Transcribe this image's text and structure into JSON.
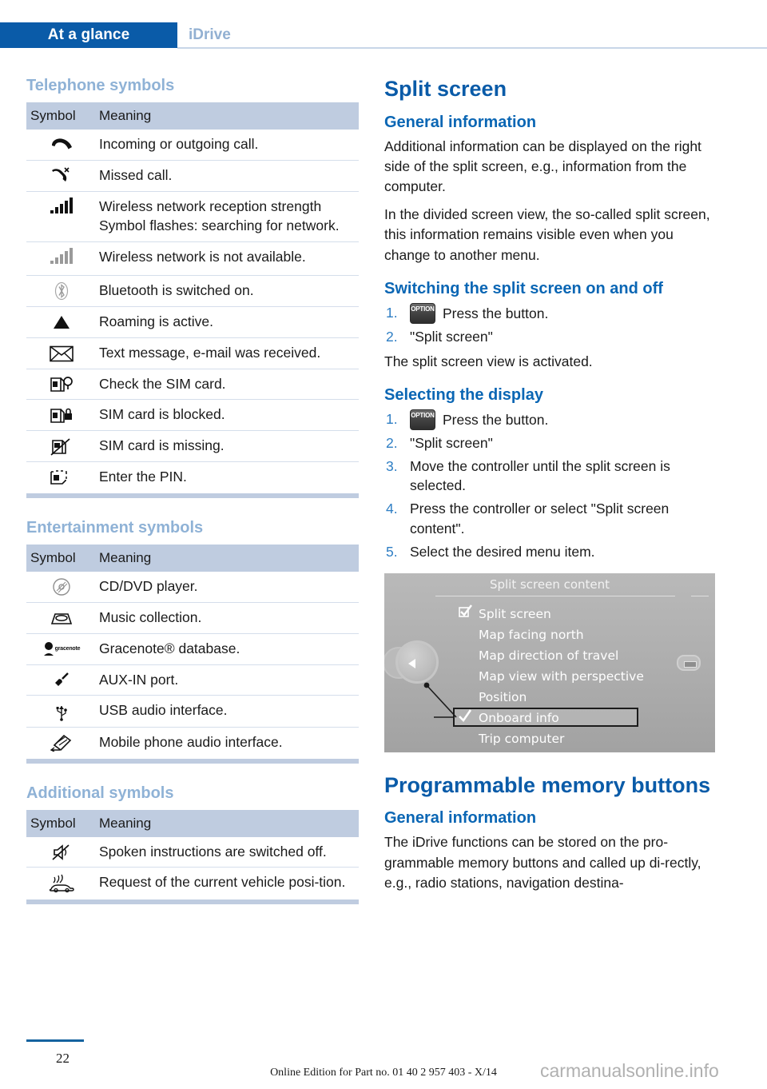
{
  "header": {
    "active_tab": "At a glance",
    "inactive_tab": "iDrive"
  },
  "left_column": {
    "telephone": {
      "heading": "Telephone symbols",
      "columns": {
        "symbol": "Symbol",
        "meaning": "Meaning"
      },
      "rows": [
        {
          "icon": "phone-handset-icon",
          "meaning": "Incoming or outgoing call."
        },
        {
          "icon": "missed-call-icon",
          "meaning": "Missed call."
        },
        {
          "icon": "signal-bars-icon",
          "meaning": "Wireless network reception strength Symbol flashes: searching for network."
        },
        {
          "icon": "signal-bars-grey-icon",
          "meaning": "Wireless network is not available."
        },
        {
          "icon": "bluetooth-icon",
          "meaning": "Bluetooth is switched on."
        },
        {
          "icon": "roaming-triangle-icon",
          "meaning": "Roaming is active."
        },
        {
          "icon": "envelope-icon",
          "meaning": "Text message, e-mail was received."
        },
        {
          "icon": "sim-check-icon",
          "meaning": "Check the SIM card."
        },
        {
          "icon": "sim-locked-icon",
          "meaning": "SIM card is blocked."
        },
        {
          "icon": "sim-missing-icon",
          "meaning": "SIM card is missing."
        },
        {
          "icon": "sim-pin-icon",
          "meaning": "Enter the PIN."
        }
      ]
    },
    "entertainment": {
      "heading": "Entertainment symbols",
      "columns": {
        "symbol": "Symbol",
        "meaning": "Meaning"
      },
      "rows": [
        {
          "icon": "cd-dvd-icon",
          "meaning": "CD/DVD player."
        },
        {
          "icon": "music-collection-icon",
          "meaning": "Music collection."
        },
        {
          "icon": "gracenote-icon",
          "icon_label": "gracenote",
          "meaning": "Gracenote® database."
        },
        {
          "icon": "aux-in-plug-icon",
          "meaning": "AUX-IN port."
        },
        {
          "icon": "usb-icon",
          "meaning": "USB audio interface."
        },
        {
          "icon": "mobile-audio-icon",
          "meaning": "Mobile phone audio interface."
        }
      ]
    },
    "additional": {
      "heading": "Additional symbols",
      "columns": {
        "symbol": "Symbol",
        "meaning": "Meaning"
      },
      "rows": [
        {
          "icon": "speaker-muted-icon",
          "meaning": "Spoken instructions are switched off."
        },
        {
          "icon": "vehicle-position-icon",
          "meaning": "Request of the current vehicle posi-tion."
        }
      ]
    }
  },
  "right_column": {
    "split_screen": {
      "title": "Split screen",
      "general_heading": "General information",
      "general_p1": "Additional information can be displayed on the right side of the split screen, e.g., information from the computer.",
      "general_p2": "In the divided screen view, the so-called split screen, this information remains visible even when you change to another menu.",
      "switching_heading": "Switching the split screen on and off",
      "switching_steps": [
        {
          "num": "1.",
          "icon": "option-button-icon",
          "icon_label": "OPTION",
          "text": "Press the button."
        },
        {
          "num": "2.",
          "text": "\"Split screen\""
        }
      ],
      "switching_result": "The split screen view is activated.",
      "selecting_heading": "Selecting the display",
      "selecting_steps": [
        {
          "num": "1.",
          "icon": "option-button-icon",
          "icon_label": "OPTION",
          "text": "Press the button."
        },
        {
          "num": "2.",
          "text": "\"Split screen\""
        },
        {
          "num": "3.",
          "text": "Move the controller until the split screen is selected."
        },
        {
          "num": "4.",
          "text": "Press the controller or select \"Split screen content\"."
        },
        {
          "num": "5.",
          "text": "Select the desired menu item."
        }
      ],
      "idrive_image": {
        "title": "Split screen content",
        "items": [
          {
            "label": "Split screen",
            "mark": "checkbox-checked-icon",
            "highlighted": false
          },
          {
            "label": "Map facing north",
            "mark": "",
            "highlighted": false
          },
          {
            "label": "Map direction of travel",
            "mark": "",
            "highlighted": false
          },
          {
            "label": "Map view with perspective",
            "mark": "",
            "highlighted": false
          },
          {
            "label": "Position",
            "mark": "",
            "highlighted": false
          },
          {
            "label": "Onboard info",
            "mark": "check-icon",
            "highlighted": true
          },
          {
            "label": "Trip computer",
            "mark": "",
            "highlighted": false
          }
        ]
      }
    },
    "memory_buttons": {
      "title": "Programmable memory buttons",
      "general_heading": "General information",
      "general_p1": "The iDrive functions can be stored on the pro-grammable memory buttons and called up di-rectly, e.g., radio stations, navigation destina-"
    }
  },
  "footer": {
    "page_number": "22",
    "note": "Online Edition for Part no. 01 40 2 957 403 - X/14",
    "watermark": "carmanualsonline.info"
  },
  "colors": {
    "brand_blue": "#0a5ba8",
    "heading_light_blue": "#8fb2d6",
    "table_header_bg": "#bfcce0",
    "step_number_blue": "#2e7ec4"
  }
}
